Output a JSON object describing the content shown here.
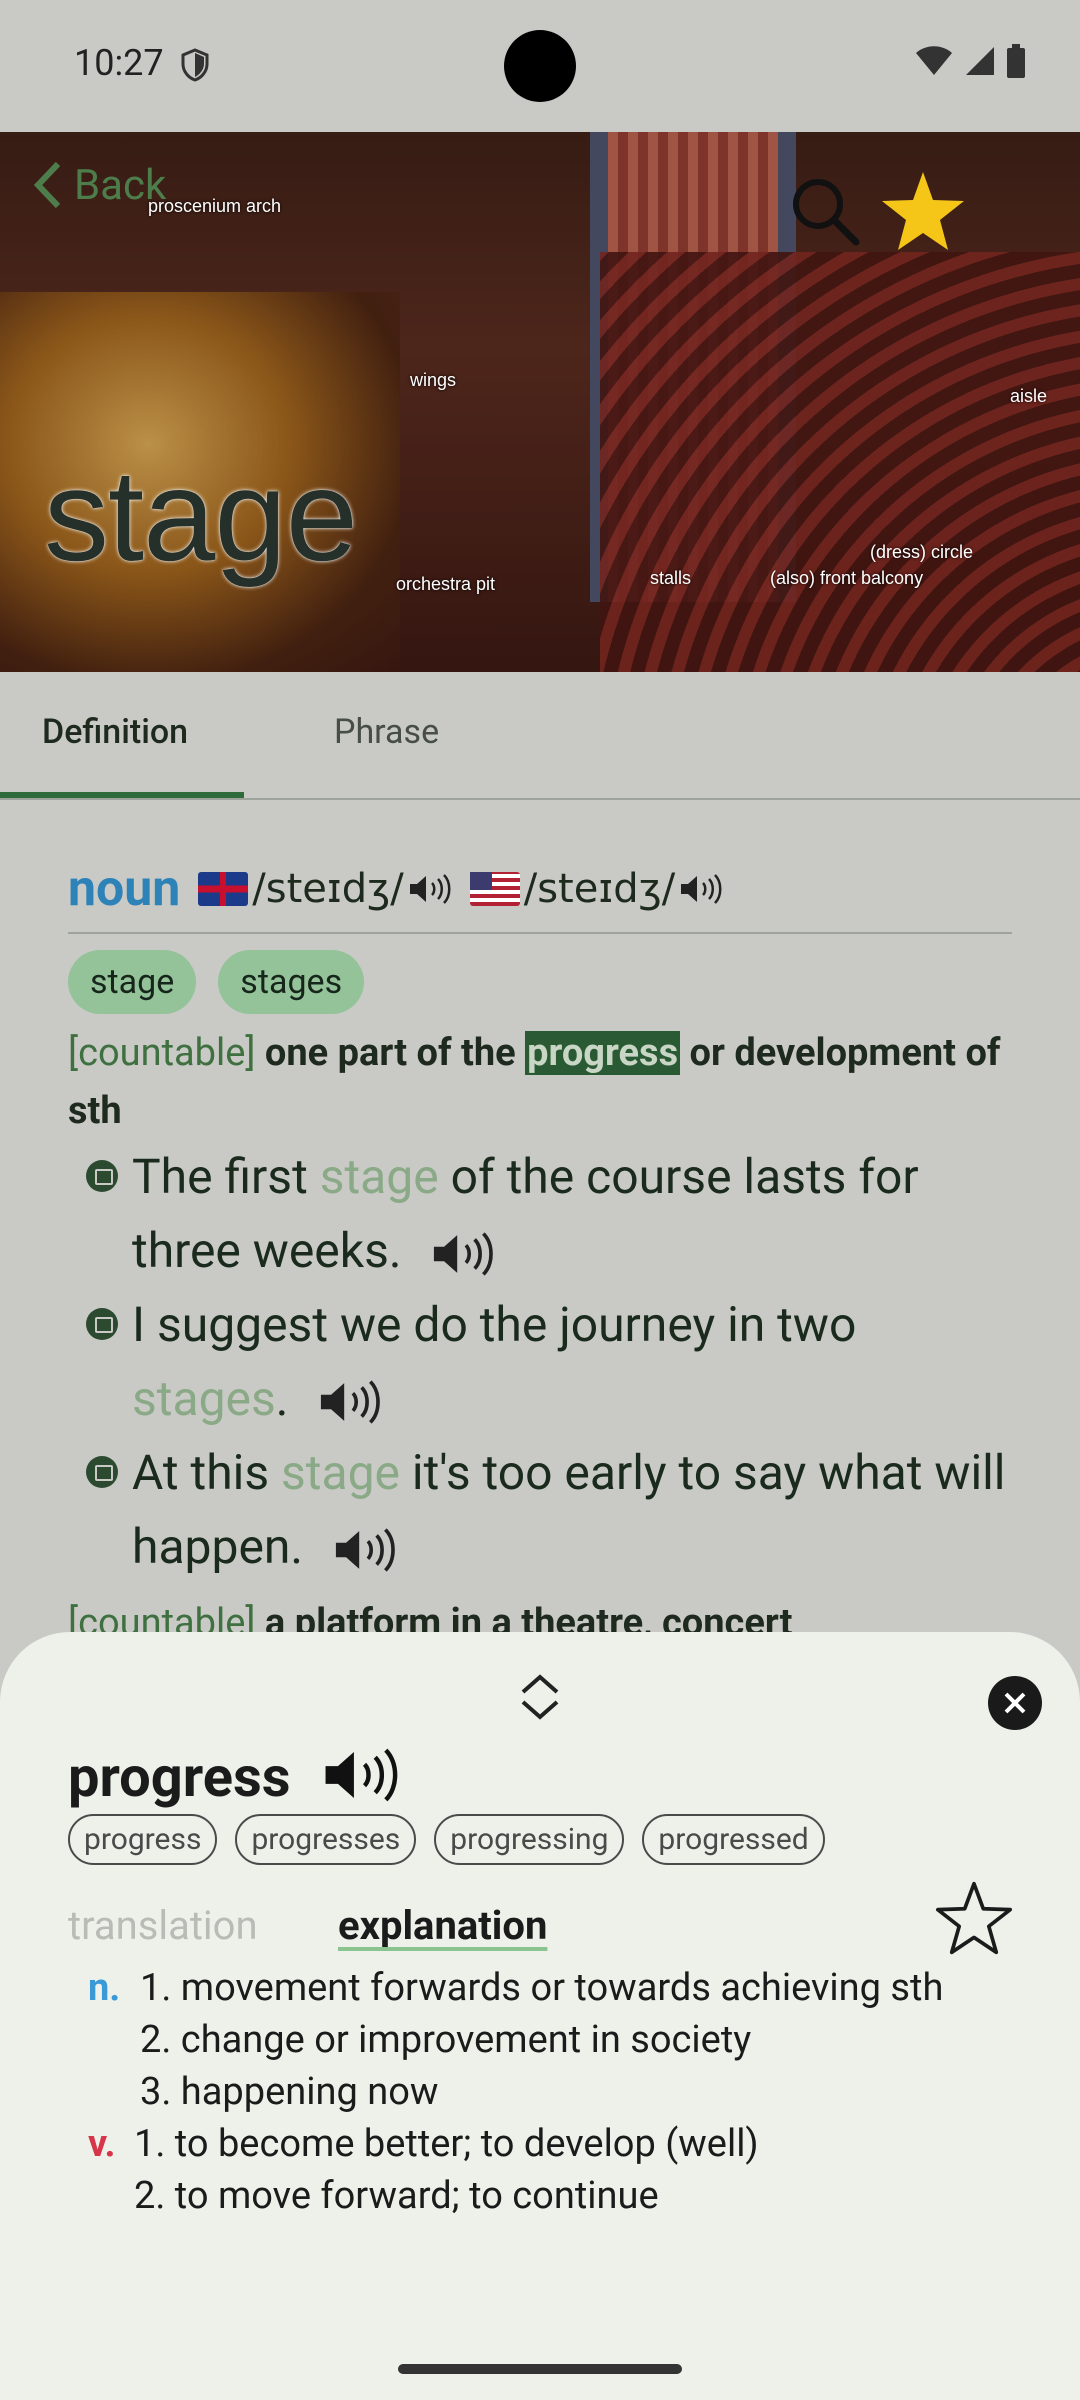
{
  "status": {
    "time": "10:27"
  },
  "hero": {
    "back_label": "Back",
    "word": "stage",
    "image_labels": [
      "proscenium arch",
      "wings",
      "orchestra pit",
      "stalls",
      "(dress) circle",
      "(also) front balcony",
      "aisle"
    ]
  },
  "tabs": [
    {
      "label": "Definition",
      "active": true
    },
    {
      "label": "Phrase",
      "active": false
    }
  ],
  "entry": {
    "pos": "noun",
    "uk_pron": "/steɪdʒ/",
    "us_pron": "/steɪdʒ/",
    "forms": [
      "stage",
      "stages"
    ],
    "sense1": {
      "label": "[countable]",
      "def_before": "one part of the",
      "def_highlight": "progress",
      "def_after": "or development of sth"
    },
    "examples": [
      {
        "before": "The first",
        "kw": "stage",
        "after": "of the course lasts for three weeks."
      },
      {
        "before": "I suggest we do the journey in two",
        "kw": "stages",
        "after": "."
      },
      {
        "before": "At this",
        "kw": "stage",
        "after": "it's too early to say what will happen."
      }
    ],
    "sense2": {
      "label": "[countable]",
      "def": "a platform in a theatre, concert"
    }
  },
  "sheet": {
    "word": "progress",
    "forms": [
      "progress",
      "progresses",
      "progressing",
      "progressed"
    ],
    "tab_translation": "translation",
    "tab_explanation": "explanation",
    "noun_pos": "n.",
    "noun_defs": [
      "1. movement forwards or towards achieving sth",
      "2. change or improvement in society",
      "3. happening now"
    ],
    "verb_pos": "v.",
    "verb_defs": [
      "1. to become better; to develop (well)",
      "2. to move forward; to continue"
    ]
  },
  "colors": {
    "accent": "#2f6a3a",
    "highlight": "#2a5a34",
    "noun": "#3a9ad8",
    "verb": "#d6354a",
    "star": "#f5c518"
  }
}
